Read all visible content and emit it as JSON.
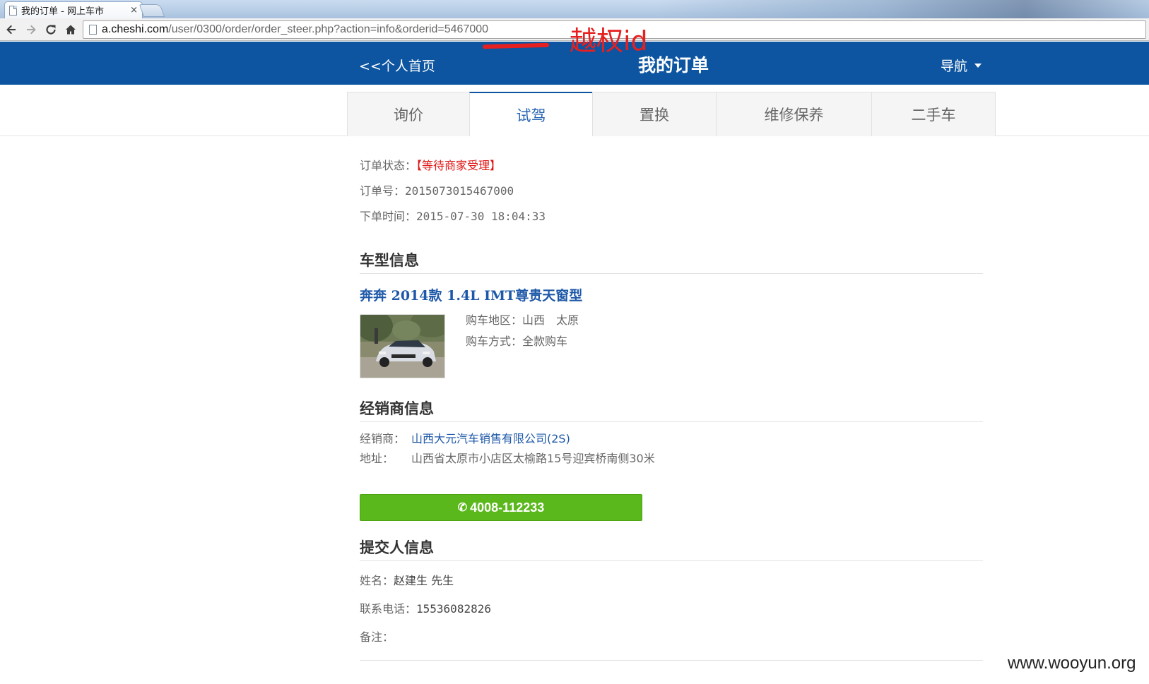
{
  "browser": {
    "tab_title": "我的订单 - 网上车市",
    "tab_close": "×",
    "url_host": "a.cheshi.com",
    "url_path": "/user/0300/order/order_steer.php?action=info&orderid=5467000",
    "icons": {
      "back": "back-arrow-icon",
      "forward": "forward-arrow-icon",
      "reload": "reload-icon",
      "home": "home-icon"
    }
  },
  "annotation": {
    "text": "越权id",
    "color": "#e62020"
  },
  "header": {
    "back_label": "<<个人首页",
    "title": "我的订单",
    "nav_label": "导航",
    "bg_color": "#0d55a0"
  },
  "tabs": [
    {
      "label": "询价"
    },
    {
      "label": "试驾",
      "active": true
    },
    {
      "label": "置换"
    },
    {
      "label": "维修保养"
    },
    {
      "label": "二手车"
    }
  ],
  "order": {
    "status_label": "订单状态：",
    "status_value": "【等待商家受理】",
    "status_color": "#e01515",
    "number_label": "订单号：",
    "number_value": "2015073015467000",
    "time_label": "下单时间：",
    "time_value": "2015-07-30 18:04:33"
  },
  "car": {
    "section_title": "车型信息",
    "model": "奔奔 2014款 1.4L IMT尊贵天窗型",
    "region_label": "购车地区：",
    "region_value": "山西　太原",
    "method_label": "购车方式：",
    "method_value": "全款购车"
  },
  "dealer": {
    "section_title": "经销商信息",
    "name_label": "经销商：",
    "name_value": "山西大元汽车销售有限公司(2S)",
    "address_label": "地址：",
    "address_value": "山西省太原市小店区太榆路15号迎宾桥南侧30米",
    "phone": "4008-112233",
    "button_color": "#5ab81c"
  },
  "submitter": {
    "section_title": "提交人信息",
    "name_label": "姓名：",
    "name_value": "赵建生 先生",
    "phone_label": "联系电话：",
    "phone_value": "15536082826",
    "remark_label": "备注：",
    "remark_value": ""
  },
  "watermark": "www.wooyun.org"
}
